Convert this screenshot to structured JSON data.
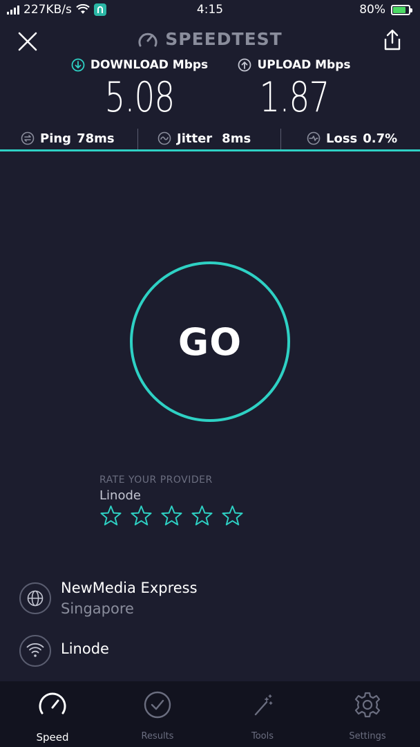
{
  "status_bar": {
    "network_speed": "227KB/s",
    "time": "4:15",
    "battery_percent": "80%",
    "battery_level": 0.8
  },
  "header": {
    "title": "SPEEDTEST"
  },
  "metrics": {
    "download_label": "DOWNLOAD Mbps",
    "download_value": "5.08",
    "upload_label": "UPLOAD Mbps",
    "upload_value": "1.87"
  },
  "stats": {
    "ping_label": "Ping",
    "ping_value": "78ms",
    "jitter_label": "Jitter",
    "jitter_value": "8ms",
    "loss_label": "Loss",
    "loss_value": "0.7%"
  },
  "go_button": {
    "label": "GO"
  },
  "rate_provider": {
    "title": "RATE YOUR PROVIDER",
    "provider": "Linode",
    "stars_total": 5,
    "stars_filled": 0
  },
  "server": {
    "name": "NewMedia Express",
    "location": "Singapore"
  },
  "isp": {
    "name": "Linode"
  },
  "bottom_nav": {
    "items": [
      {
        "label": "Speed",
        "icon": "speedometer-icon",
        "active": true
      },
      {
        "label": "Results",
        "icon": "checkmark-circle-icon",
        "active": false
      },
      {
        "label": "Tools",
        "icon": "magic-wand-icon",
        "active": false
      },
      {
        "label": "Settings",
        "icon": "gear-icon",
        "active": false
      }
    ]
  },
  "colors": {
    "background": "#1c1d2e",
    "accent": "#2ed1c4",
    "nav_background": "#12131f"
  }
}
